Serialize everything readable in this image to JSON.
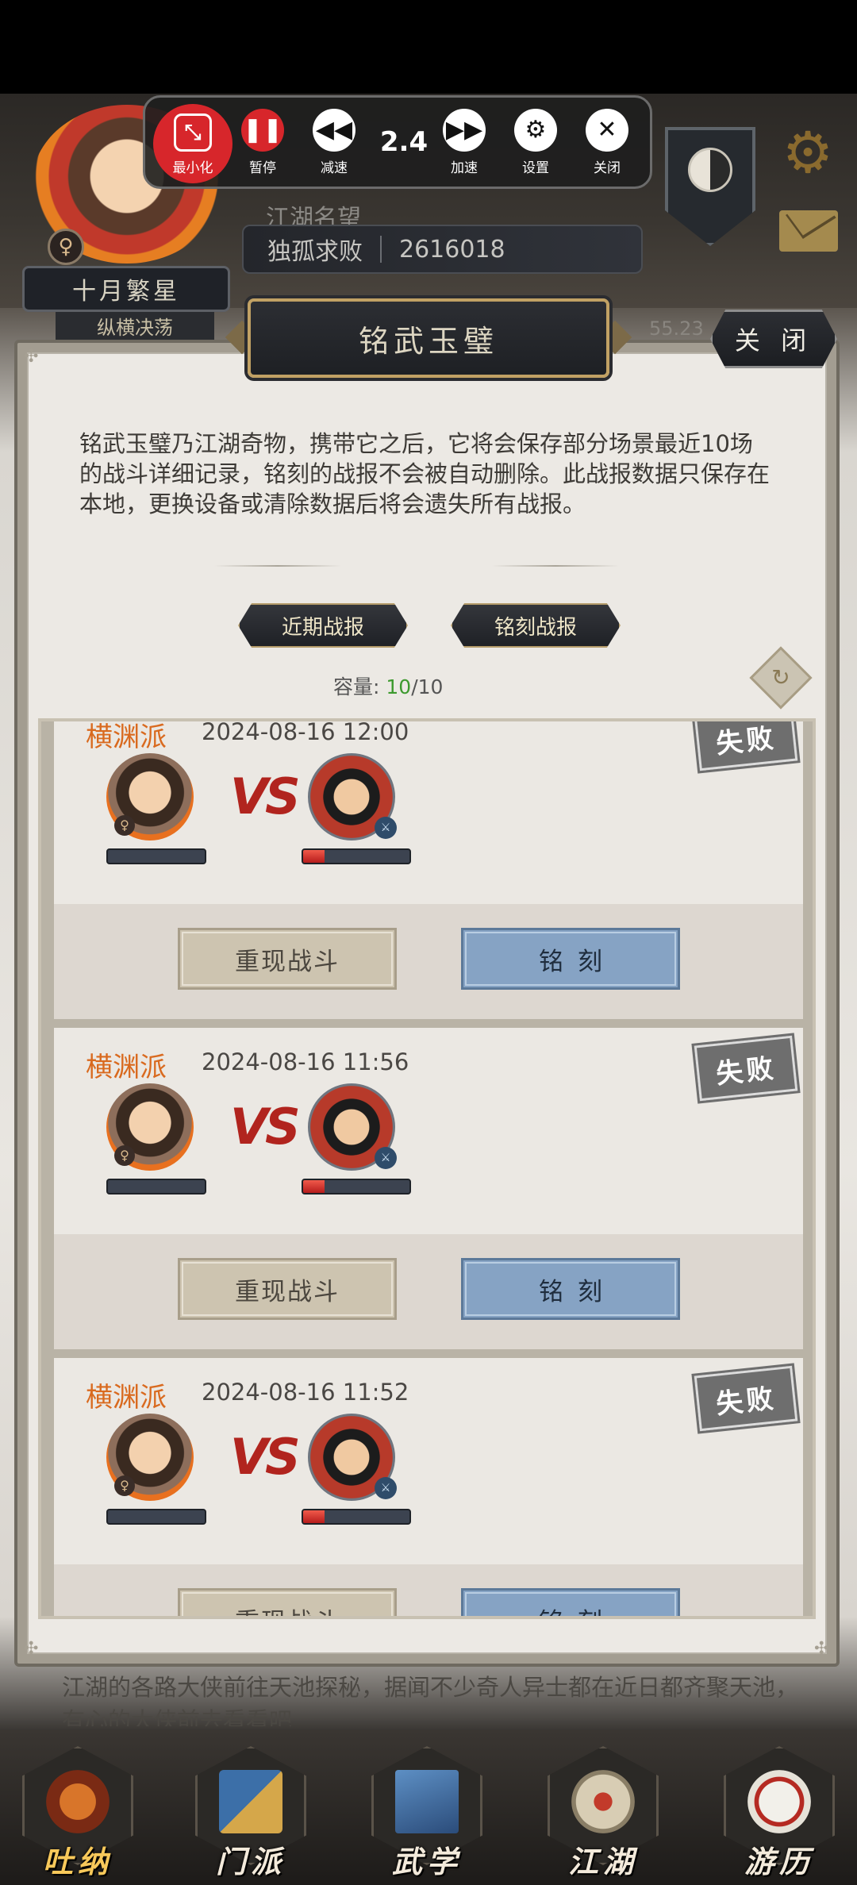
{
  "toolbar": {
    "minimize_label": "最小化",
    "pause_label": "暂停",
    "slow_label": "减速",
    "speed_value": "2.4",
    "fast_label": "加速",
    "settings_label": "设置",
    "close_label": "关闭"
  },
  "player": {
    "name": "十月繁星",
    "subtitle": "纵横决荡",
    "gender": "♀"
  },
  "fame": {
    "label": "江湖名望",
    "rank": "独孤求败",
    "value": "2616018"
  },
  "side_number": "55.23",
  "dialog": {
    "title": "铭武玉璧",
    "close_label": "关 闭",
    "description": "铭武玉璧乃江湖奇物，携带它之后，它将会保存部分场景最近10场的战斗详细记录，铭刻的战报不会被自动删除。此战报数据只保存在本地，更换设备或清除数据后将会遗失所有战报。",
    "tabs": [
      {
        "label": "近期战报"
      },
      {
        "label": "铭刻战报"
      }
    ],
    "capacity_label": "容量:",
    "capacity_used": "10",
    "capacity_total": "/10"
  },
  "records": [
    {
      "sect": "横渊派",
      "time": "2024-08-16 12:00",
      "result": "失败",
      "player_hp": 0,
      "enemy_hp": 0.2,
      "replay_label": "重现战斗",
      "engrave_label": "铭刻"
    },
    {
      "sect": "横渊派",
      "time": "2024-08-16 11:56",
      "result": "失败",
      "player_hp": 0,
      "enemy_hp": 0.2,
      "replay_label": "重现战斗",
      "engrave_label": "铭刻"
    },
    {
      "sect": "横渊派",
      "time": "2024-08-16 11:52",
      "result": "失败",
      "player_hp": 0,
      "enemy_hp": 0.2,
      "replay_label": "重现战斗",
      "engrave_label": "铭刻"
    }
  ],
  "vs_label": "VS",
  "news": "江湖的各路大侠前往天池探秘，据闻不少奇人异士都在近日都齐聚天池，有心的大侠前去看看吧",
  "nav": [
    {
      "label": "吐纳",
      "icon": "gourd-icon"
    },
    {
      "label": "门派",
      "icon": "banner-icon"
    },
    {
      "label": "武学",
      "icon": "book-icon"
    },
    {
      "label": "江湖",
      "icon": "hat-icon"
    },
    {
      "label": "游历",
      "icon": "horse-icon"
    }
  ],
  "colors": {
    "sect": "#d96a1f",
    "capacity_used": "#3d9a2e",
    "vs": "#b1241e",
    "engrave_button": "#86a3c4",
    "minimize_accent": "#d7262b"
  }
}
